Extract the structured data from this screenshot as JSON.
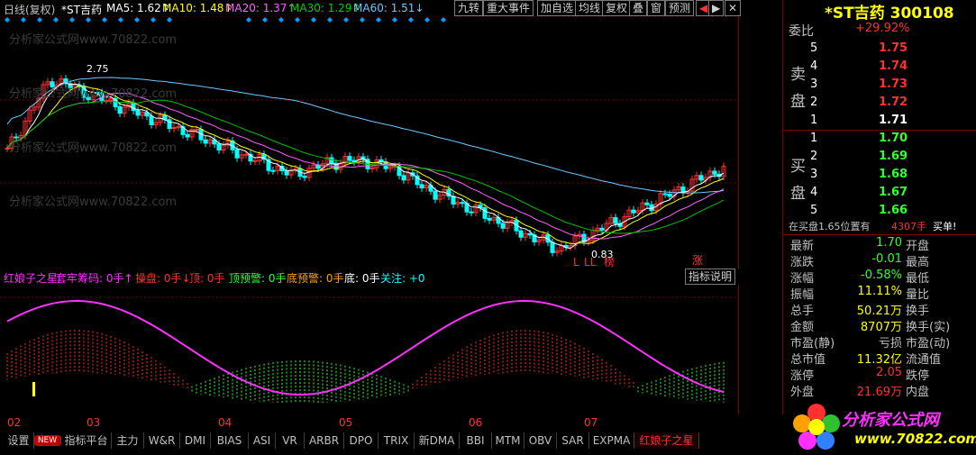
{
  "colors": {
    "up": "#ff3030",
    "down": "#00ffff",
    "ma5": "#ffffff",
    "ma10": "#ffff00",
    "ma20": "#ff60ff",
    "ma30": "#00c000",
    "ma60": "#6fc8ff",
    "magenta": "#ff30ff",
    "green": "#30ff30",
    "yellow": "#ffff00",
    "grid": "#800000"
  },
  "header": {
    "period": "日线(复权)",
    "stock": "*ST吉药",
    "ma5": "MA5: 1.62↑",
    "ma10": "MA10: 1.48↑",
    "ma20": "MA20: 1.37↑",
    "ma30": "MA30: 1.29↑",
    "ma60": "MA60: 1.51↓",
    "buttons": [
      "九转",
      "重大事件",
      "加自选",
      "均线",
      "复权",
      "叠",
      "窗",
      "预测"
    ],
    "nav_prev": "◀",
    "nav_next": "▶",
    "close": "✕"
  },
  "price_axis": [
    "3.30",
    "2.43",
    "1.57",
    "0.70"
  ],
  "annotations": {
    "high": "2.75",
    "low": "0.83",
    "marks": [
      "L",
      "LL",
      "榜"
    ],
    "zhang": "涨"
  },
  "indicator": {
    "name": "红娘子之星",
    "items": [
      "套牢筹码: 0手↑",
      "操盘: 0手↓",
      "顶: 0手",
      "顶预警: 0手",
      "底预警: 0手",
      "底: 0手",
      "关注: +0"
    ],
    "explain_btn": "指标说明",
    "axis": [
      "0",
      "0",
      "0"
    ]
  },
  "months": [
    "02",
    "03",
    "04",
    "05",
    "06",
    "07"
  ],
  "tabs": [
    "设置",
    "NEW",
    "指标平台",
    "主力",
    "W&R",
    "DMI",
    "BIAS",
    "ASI",
    "VR",
    "ARBR",
    "DPO",
    "TRIX",
    "新DMA",
    "BBI",
    "MTM",
    "OBV",
    "SAR",
    "EXPMA",
    "红娘子之星"
  ],
  "quote": {
    "title": "*ST吉药  300108",
    "weibi_label": "委比",
    "weibi_value": "+29.92%",
    "sell_label": [
      "卖",
      "盘"
    ],
    "buy_label": [
      "买",
      "盘"
    ],
    "sell": [
      {
        "n": "5",
        "p": "1.75"
      },
      {
        "n": "4",
        "p": "1.74"
      },
      {
        "n": "3",
        "p": "1.73"
      },
      {
        "n": "2",
        "p": "1.72"
      },
      {
        "n": "1",
        "p": "1.71"
      }
    ],
    "buy": [
      {
        "n": "1",
        "p": "1.70"
      },
      {
        "n": "2",
        "p": "1.69"
      },
      {
        "n": "3",
        "p": "1.68"
      },
      {
        "n": "4",
        "p": "1.67"
      },
      {
        "n": "5",
        "p": "1.66"
      }
    ],
    "status_text": "在买盘1.65位置有",
    "status_vol": "4307手",
    "status_action": "买单!",
    "stats": [
      {
        "l": "最新",
        "v": "1.70",
        "r": "开盘",
        "c": "#30ff30"
      },
      {
        "l": "涨跌",
        "v": "-0.01",
        "r": "最高",
        "c": "#30ff30"
      },
      {
        "l": "涨幅",
        "v": "-0.58%",
        "r": "最低",
        "c": "#30ff30"
      },
      {
        "l": "振幅",
        "v": "11.11%",
        "r": "量比",
        "c": "#ffff00"
      },
      {
        "l": "总手",
        "v": "50.21万",
        "r": "换手",
        "c": "#ffff00"
      },
      {
        "l": "金额",
        "v": "8707万",
        "r": "换手(实)",
        "c": "#ffff00"
      },
      {
        "l": "市盈(静)",
        "v": "亏损",
        "r": "市盈(动)",
        "c": "#c0c0c0"
      },
      {
        "l": "总市值",
        "v": "11.32亿",
        "r": "流通值",
        "c": "#ffff00"
      },
      {
        "l": "涨停",
        "v": "2.05",
        "r": "跌停",
        "c": "#ff3030"
      },
      {
        "l": "外盘",
        "v": "21.69万",
        "r": "内盘",
        "c": "#ff3030"
      }
    ]
  },
  "watermark": "分析家公式网www.70822.com",
  "logo": {
    "title": "分析家公式网",
    "url": "www.70822.com"
  }
}
